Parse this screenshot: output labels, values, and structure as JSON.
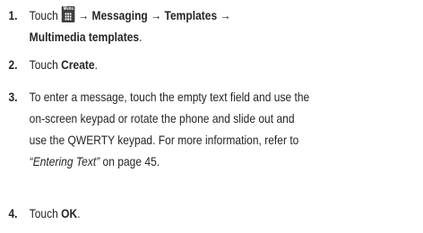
{
  "steps": [
    {
      "number": "1.",
      "icon": "menu-key-icon",
      "icon_label": "Menu",
      "arrow1": "→",
      "item1": "Messaging",
      "arrow2": "→",
      "item2": "Templates",
      "arrow3": "→",
      "item3": "Multimedia templates",
      "end": "."
    },
    {
      "number": "2.",
      "text": "Touch ",
      "bold": "Create",
      "end": "."
    },
    {
      "number": "3.",
      "line1": "To enter a message, touch the empty text field and use the",
      "line2": "on-screen keypad or rotate the phone and slide out and",
      "line3": "use the QWERTY keypad. For more information, refer to",
      "ref": "“Entering Text”",
      "page_ref": " on page 45."
    },
    {
      "number": "4.",
      "text": "Touch ",
      "bold": "OK",
      "end": "."
    }
  ]
}
